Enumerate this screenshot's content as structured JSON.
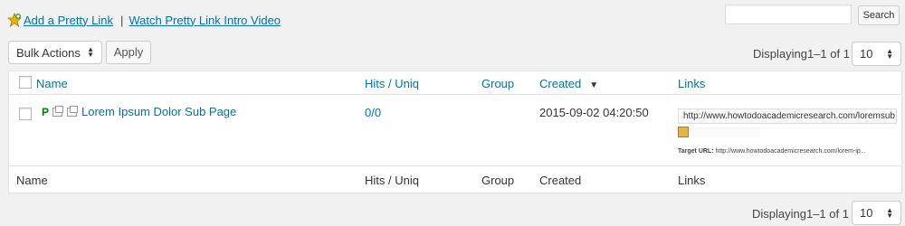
{
  "toplinks": {
    "add_link": "Add a Pretty Link",
    "separator": "|",
    "video_link": "Watch Pretty Link Intro Video"
  },
  "search": {
    "value": "",
    "button": "Search"
  },
  "bulk": {
    "selected": "Bulk Actions",
    "apply": "Apply"
  },
  "pagination": {
    "displaying": "Displaying1–1 of 1",
    "per_page": "10"
  },
  "table": {
    "headers": {
      "name": "Name",
      "hits": "Hits / Uniq",
      "group": "Group",
      "created": "Created",
      "links": "Links"
    },
    "sort_indicator": "▼",
    "rows": [
      {
        "badge": "P",
        "name": "Lorem Ipsum Dolor Sub Page",
        "hits": "0/0",
        "group": "",
        "created": "2015-09-02 04:20:50",
        "link_url": "http://www.howtodoacademicresearch.com/loremsub",
        "target_label": "Target URL:",
        "target_url": "http://www.howtodoacademicresearch.com/lorem-ip..."
      }
    ]
  },
  "colors": {
    "link": "#0073aa",
    "badge": "#008000"
  }
}
